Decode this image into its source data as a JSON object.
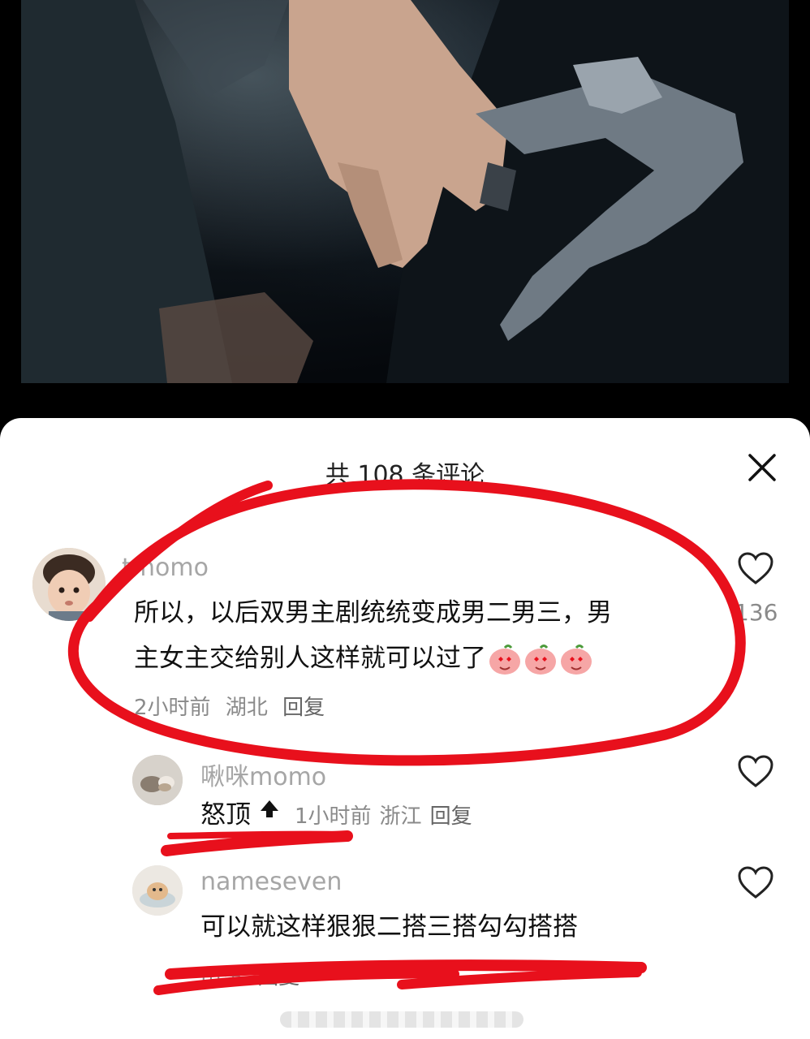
{
  "header": {
    "title": "共 108 条评论",
    "close_icon": "close-icon"
  },
  "comments": [
    {
      "username": "tmomo",
      "text_line1": "所以，以后双男主剧统统变成男二男三，男",
      "text_line2": "主女主交给别人这样就可以过了",
      "time": "2小时前",
      "location": "湖北",
      "reply": "回复",
      "likes": "136"
    },
    {
      "username": "啾咪momo",
      "text": "怒顶",
      "badge": "TOP",
      "time": "1小时前",
      "location": "浙江",
      "reply": "回复"
    },
    {
      "username": "nameseven",
      "text": "可以就这样狠狠二搭三搭勾勾搭搭",
      "location": "山东",
      "reply": "回复"
    }
  ],
  "colors": {
    "annotation": "#e8101c",
    "muted": "#8a8a8a"
  }
}
